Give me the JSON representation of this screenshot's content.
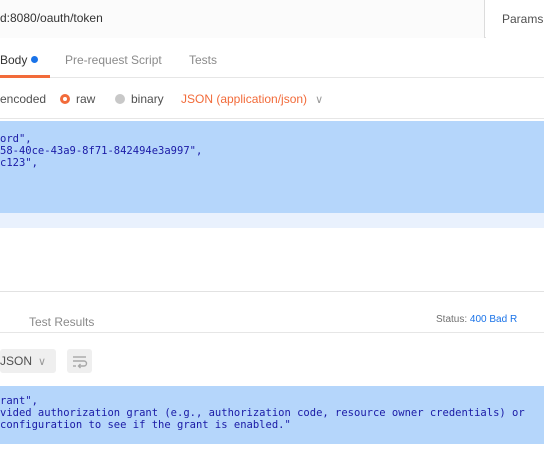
{
  "url_bar": {
    "url": "d:8080/oauth/token",
    "params_label": "Params"
  },
  "request_tabs": {
    "body_label": "Body",
    "prerequest_label": "Pre-request Script",
    "tests_label": "Tests"
  },
  "body_options": {
    "urlencoded_label": "encoded",
    "raw_label": "raw",
    "binary_label": "binary",
    "content_type": "JSON (application/json)",
    "selected": "raw"
  },
  "request_body": {
    "lines": [
      "ord\",",
      "58-40ce-43a9-8f71-842494e3a997\",",
      "c123\","
    ]
  },
  "response": {
    "tab_label": "Test Results",
    "status_label": "Status:",
    "status_value": "400 Bad R",
    "format_label": "JSON",
    "body_lines": [
      "rant\",",
      "vided authorization grant (e.g., authorization code, resource owner credentials) or",
      "configuration to see if the grant is enabled.\""
    ]
  },
  "colors": {
    "accent": "#f26b3a",
    "blue": "#1a73e8",
    "selection": "#b5d6fb",
    "code_text": "#1a1aa6"
  }
}
